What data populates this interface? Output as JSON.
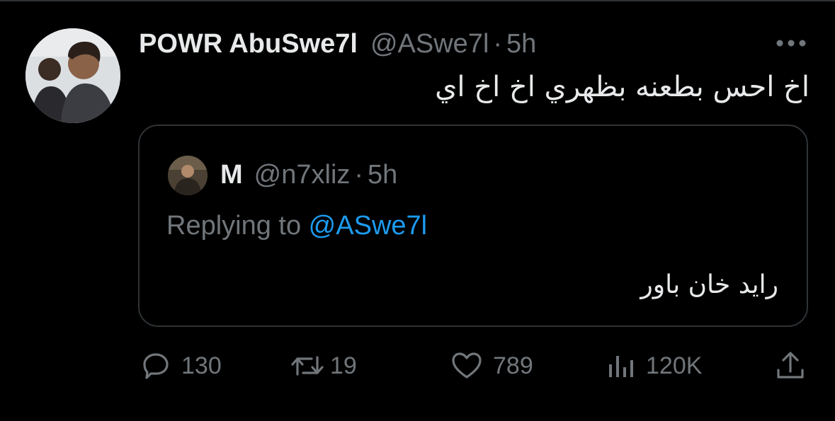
{
  "tweet": {
    "display_name": "POWR AbuSwe7l",
    "handle": "@ASwe7l",
    "separator": "·",
    "time": "5h",
    "text": "اخ احس بطعنه بظهري اخ اخ اي"
  },
  "quoted": {
    "display_name": "M",
    "handle": "@n7xliz",
    "separator": "·",
    "time": "5h",
    "replying_prefix": "Replying to ",
    "replying_handle": "@ASwe7l",
    "text": "رايد خان باور"
  },
  "actions": {
    "replies": "130",
    "reposts": "19",
    "likes": "789",
    "views": "120K"
  },
  "colors": {
    "background": "#000000",
    "text": "#e7e9ea",
    "secondary": "#71767b",
    "link": "#1d9bf0",
    "border": "#2f3336"
  },
  "icons": [
    "more-icon",
    "reply-icon",
    "repost-icon",
    "like-icon",
    "views-icon",
    "share-icon"
  ]
}
